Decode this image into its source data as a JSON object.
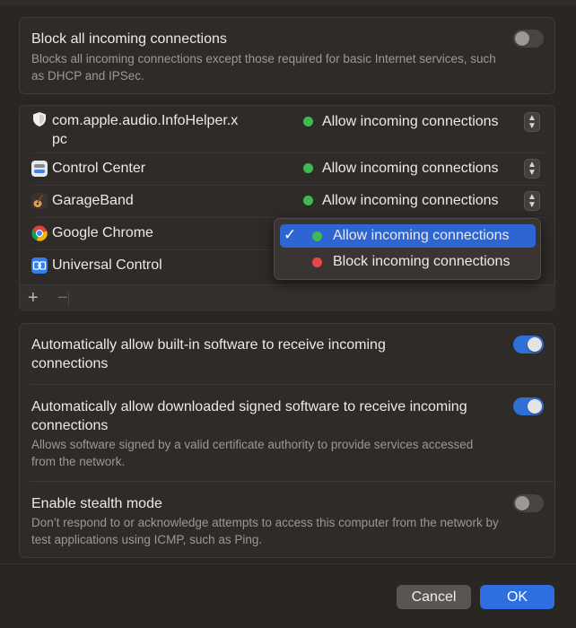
{
  "block_all": {
    "title": "Block all incoming connections",
    "description": "Blocks all incoming connections except those required for basic Internet services, such as DHCP and IPSec.",
    "enabled": false
  },
  "apps": [
    {
      "name": "com.apple.audio.InfoHelper.x\npc",
      "status": "Allow incoming connections",
      "icon": "shield-icon"
    },
    {
      "name": "Control Center",
      "status": "Allow incoming connections",
      "icon": "control-center-icon"
    },
    {
      "name": "GarageBand",
      "status": "Allow incoming connections",
      "icon": "garageband-icon"
    },
    {
      "name": "Google Chrome",
      "status": "",
      "icon": "chrome-icon"
    },
    {
      "name": "Universal Control",
      "status": "",
      "icon": "universal-control-icon"
    }
  ],
  "list_footer": {
    "add": "+",
    "remove": "−"
  },
  "menu": {
    "items": [
      {
        "label": "Allow incoming connections",
        "selected": true,
        "dot_color": "#3fb950"
      },
      {
        "label": "Block incoming connections",
        "selected": false,
        "dot_color": "#e5484d"
      }
    ],
    "checkmark": "✓"
  },
  "settings": {
    "builtin": {
      "title": "Automatically allow built-in software to receive incoming connections",
      "enabled": true
    },
    "signed": {
      "title": "Automatically allow downloaded signed software to receive incoming connections",
      "description": "Allows software signed by a valid certificate authority to provide services accessed from the network.",
      "enabled": true
    },
    "stealth": {
      "title": "Enable stealth mode",
      "description": "Don’t respond to or acknowledge attempts to access this computer from the network by test applications using ICMP, such as Ping.",
      "enabled": false
    }
  },
  "buttons": {
    "cancel": "Cancel",
    "ok": "OK"
  },
  "colors": {
    "allow_dot": "#3fb950",
    "block_dot": "#e5484d",
    "accent": "#2d6fe0"
  }
}
